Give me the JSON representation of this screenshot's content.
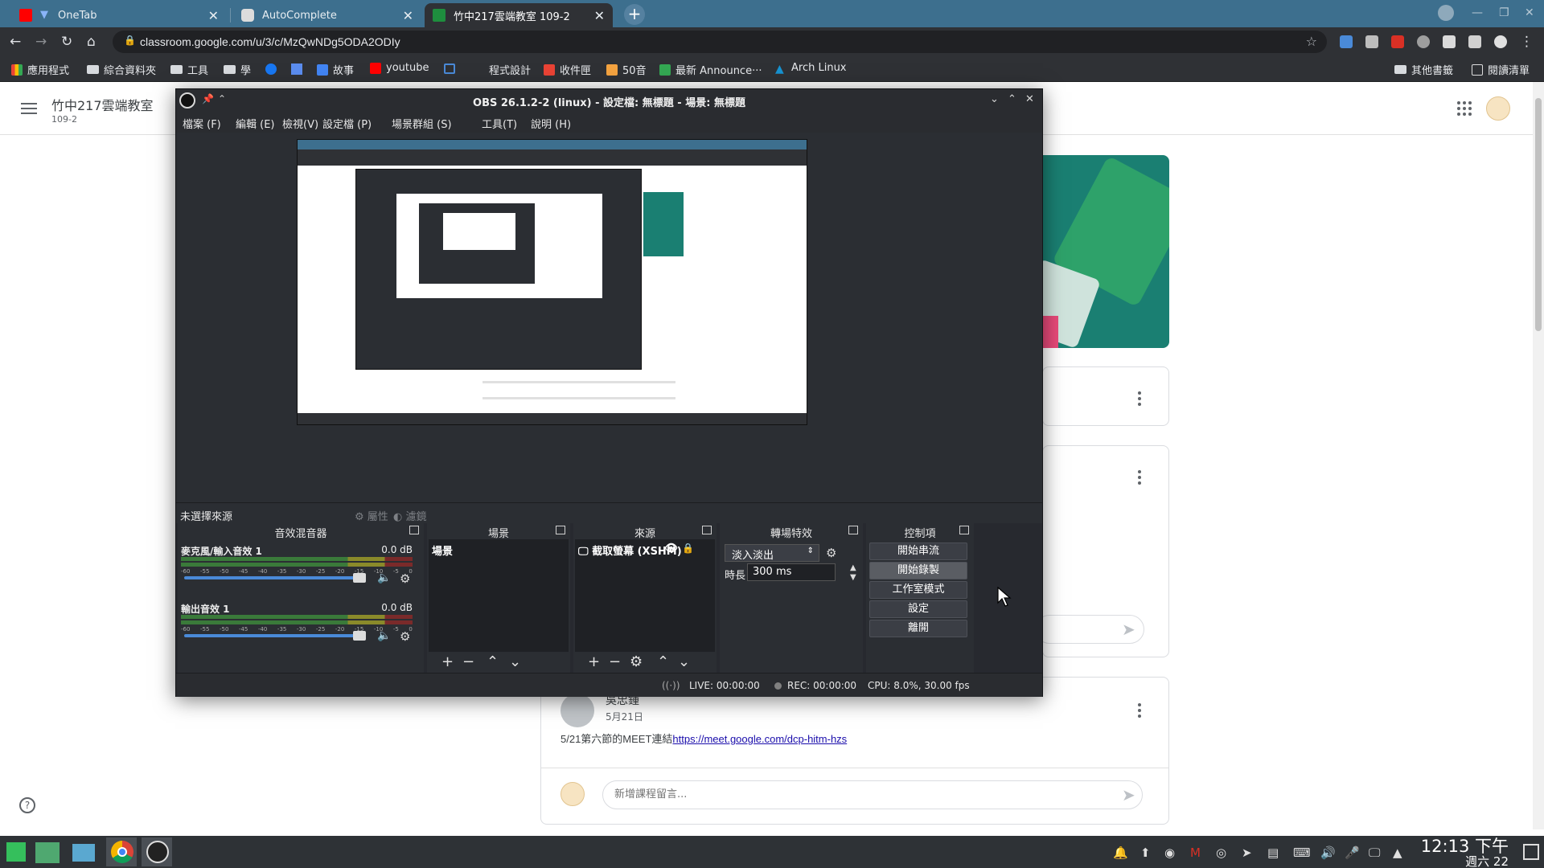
{
  "browser": {
    "tabs": [
      {
        "title": "OneTab",
        "icon": "youtube-favicon"
      },
      {
        "title": "AutoComplete",
        "icon": "discord-favicon"
      },
      {
        "title": "竹中217雲端教室 109-2",
        "icon": "classroom-favicon",
        "active": true
      }
    ],
    "url": "classroom.google.com/u/3/c/MzQwNDg5ODA2ODIy",
    "bookmarks": [
      "應用程式",
      "綜合資料夾",
      "工具",
      "學",
      "故事",
      "youtube",
      "程式設計",
      "收件匣",
      "50音",
      "最新 Announce···",
      "Arch Linux"
    ],
    "bookmarks_right": [
      "其他書籤",
      "閱讀清單"
    ],
    "accent_color": "#3d6f8e"
  },
  "classroom": {
    "title": "竹中217雲端教室",
    "subtitle": "109-2",
    "post": {
      "author": "吳忠鍾",
      "date": "5月21日",
      "text_prefix": "5/21第六節的MEET連結",
      "link": "https://meet.google.com/dcp-hitm-hzs"
    },
    "comment_placeholder": "新增課程留言..."
  },
  "obs": {
    "title": "OBS 26.1.2-2 (linux) - 設定檔: 無標題 - 場景: 無標題",
    "menu": [
      "檔案 (F)",
      "編輯 (E)",
      "檢視(V)",
      "設定檔 (P)",
      "場景群組 (S)",
      "工具(T)",
      "說明 (H)"
    ],
    "source_bar": {
      "label": "未選擇來源",
      "properties": "屬性",
      "filters": "濾鏡"
    },
    "docks": {
      "mixer": "音效混音器",
      "scenes": "場景",
      "sources": "來源",
      "transitions": "轉場特效",
      "controls": "控制項"
    },
    "mixer_channels": [
      {
        "name": "麥克風/輸入音效 1",
        "db": "0.0 dB"
      },
      {
        "name": "輸出音效 1",
        "db": "0.0 dB"
      }
    ],
    "meter_ticks": [
      "-60",
      "-55",
      "-50",
      "-45",
      "-40",
      "-35",
      "-30",
      "-25",
      "-20",
      "-15",
      "-10",
      "-5",
      "0"
    ],
    "scene_item": "場景",
    "source_item": "截取螢幕 (XSHM)",
    "transition": {
      "type": "淡入淡出",
      "duration_label": "時長",
      "duration": "300 ms"
    },
    "controls": [
      "開始串流",
      "開始錄製",
      "工作室模式",
      "設定",
      "離開"
    ],
    "status": {
      "live": "LIVE: 00:00:00",
      "rec": "REC: 00:00:00",
      "cpu": "CPU: 8.0%, 30.00 fps"
    }
  },
  "taskbar": {
    "time": "12:13 下午",
    "day": "週六 22"
  }
}
